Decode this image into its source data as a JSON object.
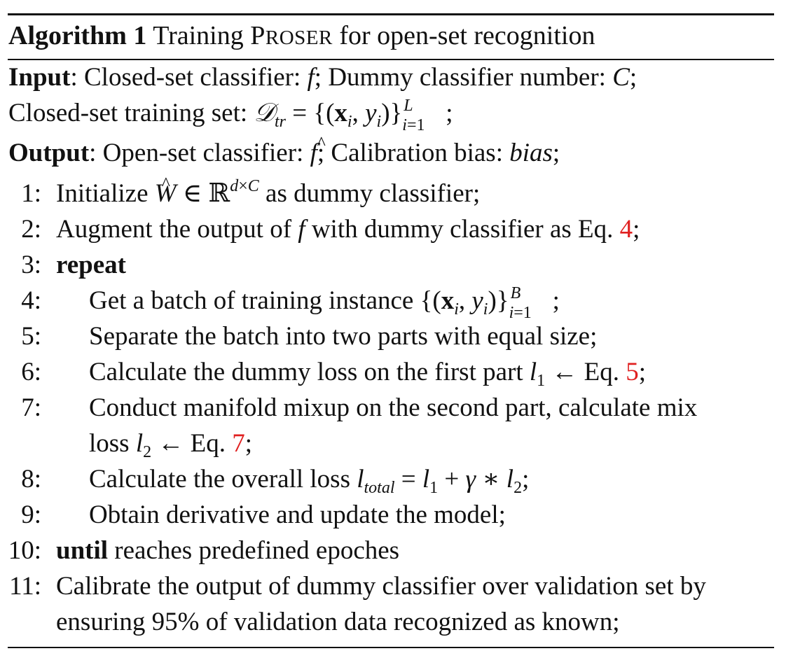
{
  "algorithm": {
    "label": "Algorithm 1",
    "title_pre": "Training",
    "title_name": "PROSER",
    "title_post": "for open-set recognition"
  },
  "io": {
    "input_label": "Input",
    "input_line1": ": Closed-set classifier: f; Dummy classifier number: C;",
    "input_line2": "Closed-set training set: 𝒟tr = {(xi, yi)}i=1L;",
    "output_label": "Output",
    "output_line": ": Open-set classifier: f̂; Calibration bias: bias;"
  },
  "steps": [
    {
      "num": "1:",
      "text": "Initialize Ŵ ∈ ℝd×C as dummy classifier;"
    },
    {
      "num": "2:",
      "text": "Augment the output of f with dummy classifier as Eq. 4;",
      "ref": "4"
    },
    {
      "num": "3:",
      "keyword": "repeat"
    },
    {
      "num": "4:",
      "text": "Get a batch of training instance {(xi, yi)}i=1B;"
    },
    {
      "num": "5:",
      "text": "Separate the batch into two parts with equal size;"
    },
    {
      "num": "6:",
      "text": "Calculate the dummy loss on the first part l1 ← Eq. 5;",
      "ref": "5"
    },
    {
      "num": "7:",
      "text": "Conduct manifold mixup on the second part, calculate mix",
      "text_cont": "loss l2 ← Eq. 7;",
      "ref": "7"
    },
    {
      "num": "8:",
      "text": "Calculate the overall loss ltotal = l1 + γ ∗ l2;"
    },
    {
      "num": "9:",
      "text": "Obtain derivative and update the model;"
    },
    {
      "num": "10:",
      "keyword": "until",
      "text": "reaches predefined epoches"
    },
    {
      "num": "11:",
      "text": "Calibrate the output of dummy classifier over validation set by",
      "text_cont": "ensuring 95% of validation data recognized as known;"
    }
  ],
  "colors": {
    "text": "#111111",
    "reference": "#e02020"
  }
}
